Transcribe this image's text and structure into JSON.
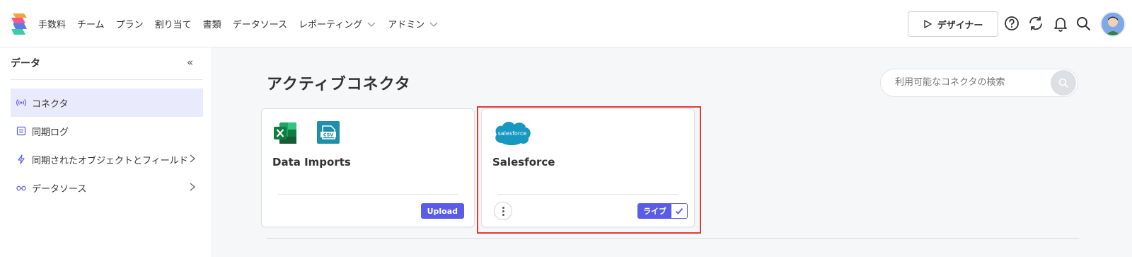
{
  "nav": {
    "items": [
      {
        "label": "手数料",
        "has_dropdown": false
      },
      {
        "label": "チーム",
        "has_dropdown": false
      },
      {
        "label": "プラン",
        "has_dropdown": false
      },
      {
        "label": "割り当て",
        "has_dropdown": false
      },
      {
        "label": "書類",
        "has_dropdown": false
      },
      {
        "label": "データソース",
        "has_dropdown": false
      },
      {
        "label": "レポーティング",
        "has_dropdown": true
      },
      {
        "label": "アドミン",
        "has_dropdown": true
      }
    ],
    "designer_label": "デザイナー"
  },
  "sidebar": {
    "title": "データ",
    "collapse_glyph": "«",
    "items": [
      {
        "label": "コネクタ",
        "icon": "broadcast-icon",
        "active": true
      },
      {
        "label": "同期ログ",
        "icon": "log-icon",
        "active": false
      },
      {
        "label": "同期されたオブジェクトとフィールド",
        "icon": "lightning-icon",
        "active": false,
        "has_arrow": true
      },
      {
        "label": "データソース",
        "icon": "glasses-icon",
        "active": false,
        "has_arrow": true
      }
    ]
  },
  "main": {
    "title": "アクティブコネクタ",
    "search_placeholder": "利用可能なコネクタの検索",
    "cards": [
      {
        "title": "Data Imports",
        "action_label": "Upload",
        "icons": [
          "excel-icon",
          "csv-icon"
        ]
      },
      {
        "title": "Salesforce",
        "status_label": "ライブ",
        "logo_text": "salesforce",
        "icons": [
          "salesforce-logo"
        ]
      }
    ]
  },
  "colors": {
    "accent": "#5a5ce8",
    "highlight": "#e53935",
    "active_bg": "#e9eafc"
  }
}
